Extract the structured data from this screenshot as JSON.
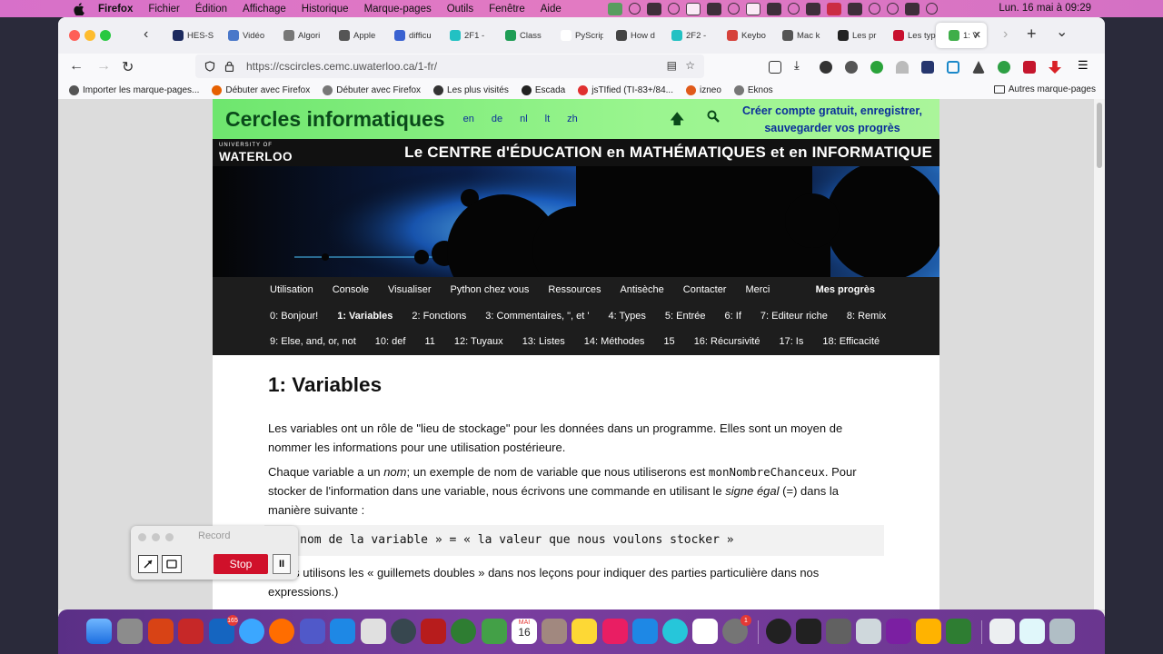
{
  "menubar": {
    "apple": "",
    "items": [
      "Firefox",
      "Fichier",
      "Édition",
      "Affichage",
      "Historique",
      "Marque-pages",
      "Outils",
      "Fenêtre",
      "Aide"
    ],
    "clock": "Lun. 16 mai à 09:29"
  },
  "browser": {
    "tabs": [
      {
        "label": "HES-S",
        "color": "#1c2a5e"
      },
      {
        "label": "Vidéo",
        "color": "#4a78c9"
      },
      {
        "label": "Algori",
        "color": "#777777"
      },
      {
        "label": "Apple",
        "color": "#555555"
      },
      {
        "label": "difficu",
        "color": "#3a62d1"
      },
      {
        "label": "2F1 -",
        "color": "#22c1c3"
      },
      {
        "label": "Class",
        "color": "#1f9d55"
      },
      {
        "label": "PyScript |",
        "color": "#ffffff"
      },
      {
        "label": "How d",
        "color": "#444444"
      },
      {
        "label": "2F2 -",
        "color": "#22c1c3"
      },
      {
        "label": "Keybo",
        "color": "#d6423b"
      },
      {
        "label": "Mac k",
        "color": "#555555"
      },
      {
        "label": "Les pr",
        "color": "#222222"
      },
      {
        "label": "Les typ",
        "color": "#c8102e"
      },
      {
        "label": "1: V",
        "color": "#3fae49",
        "active": true
      }
    ],
    "tab_close": "✕",
    "new_tab": "+",
    "tab_list": "⌄",
    "tab_scroll_left": "‹",
    "tab_scroll_right": "›",
    "url": "https://cscircles.cemc.uwaterloo.ca/1-fr/",
    "bookmarks": [
      {
        "label": "Importer les marque-pages...",
        "color": "#555555"
      },
      {
        "label": "Débuter avec Firefox",
        "color": "#e66000"
      },
      {
        "label": "Débuter avec Firefox",
        "color": "#777777"
      },
      {
        "label": "Les plus visités",
        "color": "#333333"
      },
      {
        "label": "Escada",
        "color": "#222222"
      },
      {
        "label": "jsTIfied (TI-83+/84...",
        "color": "#e03030"
      },
      {
        "label": "izneo",
        "color": "#e05a1a"
      },
      {
        "label": "Eknos",
        "color": "#777777"
      }
    ],
    "other_bookmarks": "Autres marque-pages"
  },
  "site": {
    "title": "Cercles informatiques",
    "langs": [
      "en",
      "de",
      "nl",
      "lt",
      "zh"
    ],
    "register": [
      "Créer compte gratuit, enregistrer,",
      "sauvegarder vos progrès"
    ],
    "uw_small": "UNIVERSITY OF",
    "uw_big": "WATERLOO",
    "center": "Le CENTRE d'ÉDUCATION en MATHÉMATIQUES et en INFORMATIQUE",
    "nav_top": [
      "Utilisation",
      "Console",
      "Visualiser",
      "Python chez vous",
      "Ressources",
      "Antisèche",
      "Contacter",
      "Merci"
    ],
    "mes_progres": "Mes progrès",
    "nav_lessons_1": [
      "0: Bonjour!",
      "1: Variables",
      "2: Fonctions",
      "3: Commentaires, \", et '",
      "4: Types",
      "5: Entrée",
      "6: If",
      "7: Editeur riche",
      "8: Remix"
    ],
    "nav_lessons_2": [
      "9: Else, and, or, not",
      "10: def",
      "11",
      "12: Tuyaux",
      "13: Listes",
      "14: Méthodes",
      "15",
      "16: Récursivité",
      "17: Is",
      "18: Efficacité"
    ]
  },
  "lesson": {
    "heading": "1: Variables",
    "p1": "Les variables ont un rôle de \"lieu de stockage\" pour les données dans un programme. Elles sont un moyen de nommer les informations pour une utilisation postérieure.",
    "p2a": "Chaque variable a un ",
    "p2_nom": "nom",
    "p2b": "; un exemple de nom de variable que nous utiliserons est ",
    "p2_code": "monNombreChanceux",
    "p2c": ". Pour stocker de l'information dans une variable, nous écrivons une commande en utilisant le ",
    "p2_signe": "signe égal",
    "p2d": " (=) dans la manière suivante :",
    "code": "« le nom de la variable » = « la valeur que nous voulons stocker »",
    "p3": "(Nous utilisons les « guillemets doubles » dans nos leçons pour indiquer des parties particulière dans nos expressions.)"
  },
  "recorder": {
    "title": "Record",
    "stop": "Stop",
    "pause": "II"
  },
  "dock": {
    "badges": {
      "outlook": "165",
      "sysprefs": "1"
    },
    "calendar_month": "MAI",
    "calendar_day": "16"
  }
}
